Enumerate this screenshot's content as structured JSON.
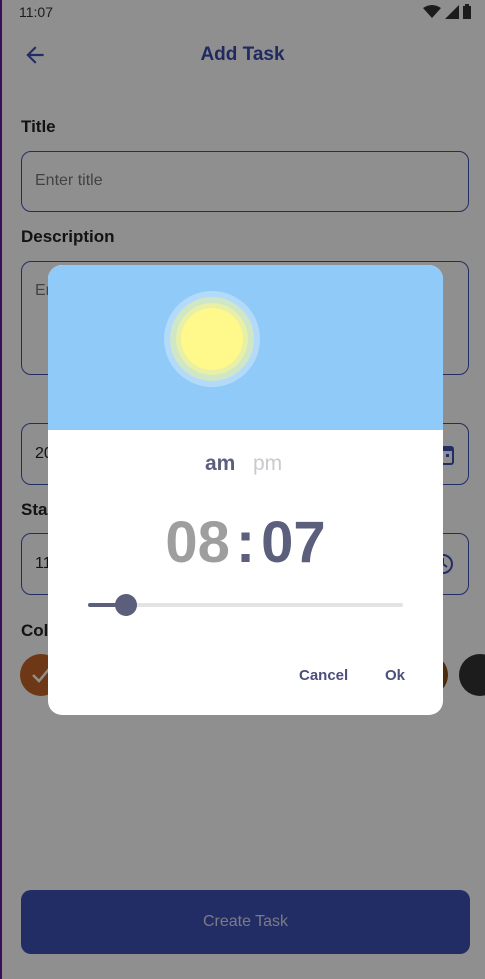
{
  "status_bar": {
    "time": "11:07"
  },
  "app_bar": {
    "title": "Add Task"
  },
  "form": {
    "title_label": "Title",
    "title_placeholder": "Enter title",
    "description_label": "Description",
    "description_placeholder_partial": "En",
    "date_value_partial": "20",
    "start_label_partial": "Sta",
    "start_value_partial": "11",
    "color_label_partial": "Col"
  },
  "create_button": {
    "label": "Create Task"
  },
  "time_picker": {
    "am_label": "am",
    "pm_label": "pm",
    "selected_period": "am",
    "hour": "08",
    "separator": ":",
    "minute": "07",
    "slider_value_fraction": 0.12,
    "cancel_label": "Cancel",
    "ok_label": "Ok"
  },
  "colors": {
    "accent": "#3f51b5",
    "sky": "#90caf9",
    "sun": "#fff88a",
    "swatch_orange": "#c4652a",
    "swatch_brown": "#8a4c12",
    "swatch_dark": "#333333"
  },
  "icons": [
    "back-arrow-icon",
    "wifi-icon",
    "signal-icon",
    "battery-icon",
    "calendar-icon",
    "clock-icon",
    "check-icon",
    "sun-icon"
  ]
}
